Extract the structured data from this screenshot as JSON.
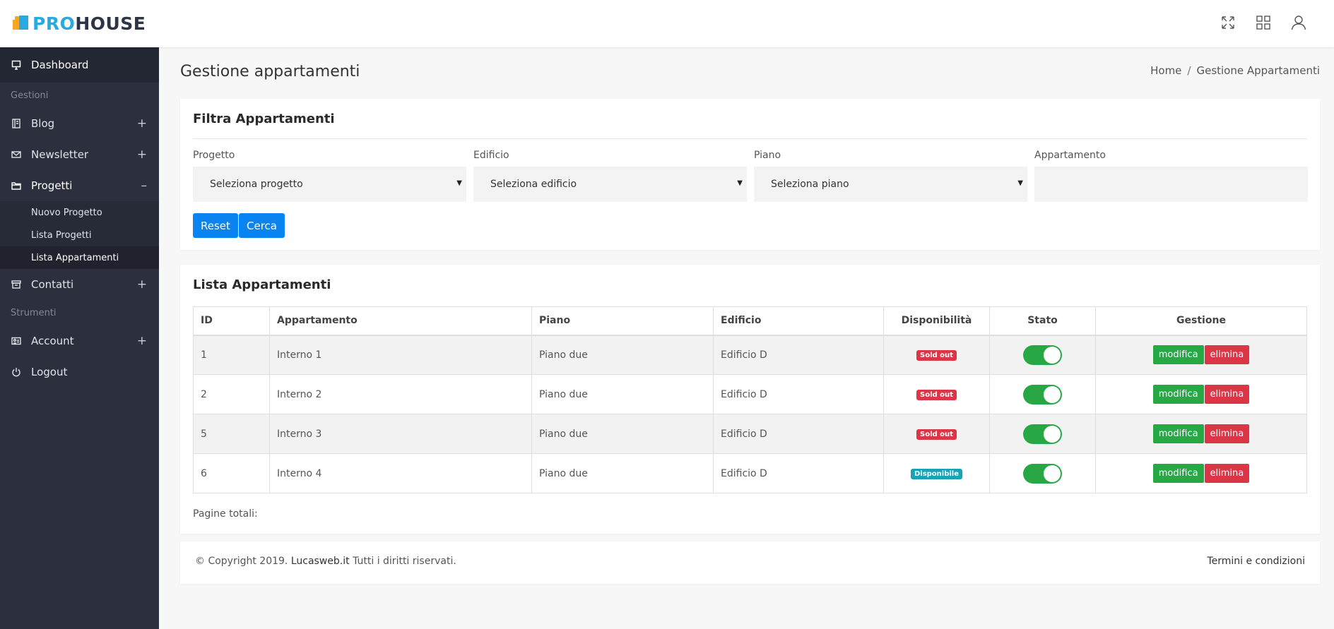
{
  "brand": {
    "pro": "PRO",
    "house": "HOUSE"
  },
  "topbar": {
    "icons": [
      "fullscreen-icon",
      "apps-grid-icon",
      "user-icon"
    ]
  },
  "sidebar": {
    "dashboard": "Dashboard",
    "section_gestioni": "Gestioni",
    "blog": "Blog",
    "newsletter": "Newsletter",
    "progetti": "Progetti",
    "sub": {
      "nuovo": "Nuovo Progetto",
      "lista": "Lista Progetti",
      "appartamenti": "Lista Appartamenti"
    },
    "contatti": "Contatti",
    "section_strumenti": "Strumenti",
    "account": "Account",
    "logout": "Logout",
    "plus": "+",
    "minus": "–"
  },
  "page": {
    "title": "Gestione appartamenti",
    "breadcrumb": {
      "home": "Home",
      "sep": "/",
      "current": "Gestione Appartamenti"
    }
  },
  "filter": {
    "title": "Filtra Appartamenti",
    "progetto": {
      "label": "Progetto",
      "value": "Seleziona progetto"
    },
    "edificio": {
      "label": "Edificio",
      "value": "Seleziona edificio"
    },
    "piano": {
      "label": "Piano",
      "value": "Seleziona piano"
    },
    "appartamento": {
      "label": "Appartamento",
      "value": ""
    },
    "reset": "Reset",
    "cerca": "Cerca"
  },
  "list": {
    "title": "Lista Appartamenti",
    "headers": [
      "ID",
      "Appartamento",
      "Piano",
      "Edificio",
      "Disponibilità",
      "Stato",
      "Gestione"
    ],
    "rows": [
      {
        "id": "1",
        "appartamento": "Interno 1",
        "piano": "Piano due",
        "edificio": "Edificio D",
        "disponibilita": "Sold out",
        "stato": "on"
      },
      {
        "id": "2",
        "appartamento": "Interno 2",
        "piano": "Piano due",
        "edificio": "Edificio D",
        "disponibilita": "Sold out",
        "stato": "on"
      },
      {
        "id": "5",
        "appartamento": "Interno 3",
        "piano": "Piano due",
        "edificio": "Edificio D",
        "disponibilita": "Sold out",
        "stato": "on"
      },
      {
        "id": "6",
        "appartamento": "Interno 4",
        "piano": "Piano due",
        "edificio": "Edificio D",
        "disponibilita": "Disponibile",
        "stato": "on"
      }
    ],
    "modifica": "modifica",
    "elimina": "elimina",
    "pages_label": "Pagine totali:"
  },
  "footer": {
    "copyright": "© Copyright 2019.",
    "brand": "Lucasweb.it",
    "rights": "Tutti i diritti riservati.",
    "terms": "Termini e condizioni"
  },
  "colors": {
    "accent": "#0a84f0",
    "sidebar": "#2c2f3d",
    "success": "#28a745",
    "danger": "#dc3545",
    "info": "#17a2b8",
    "brand_blue": "#2aa8e0",
    "brand_orange": "#f5a623"
  }
}
